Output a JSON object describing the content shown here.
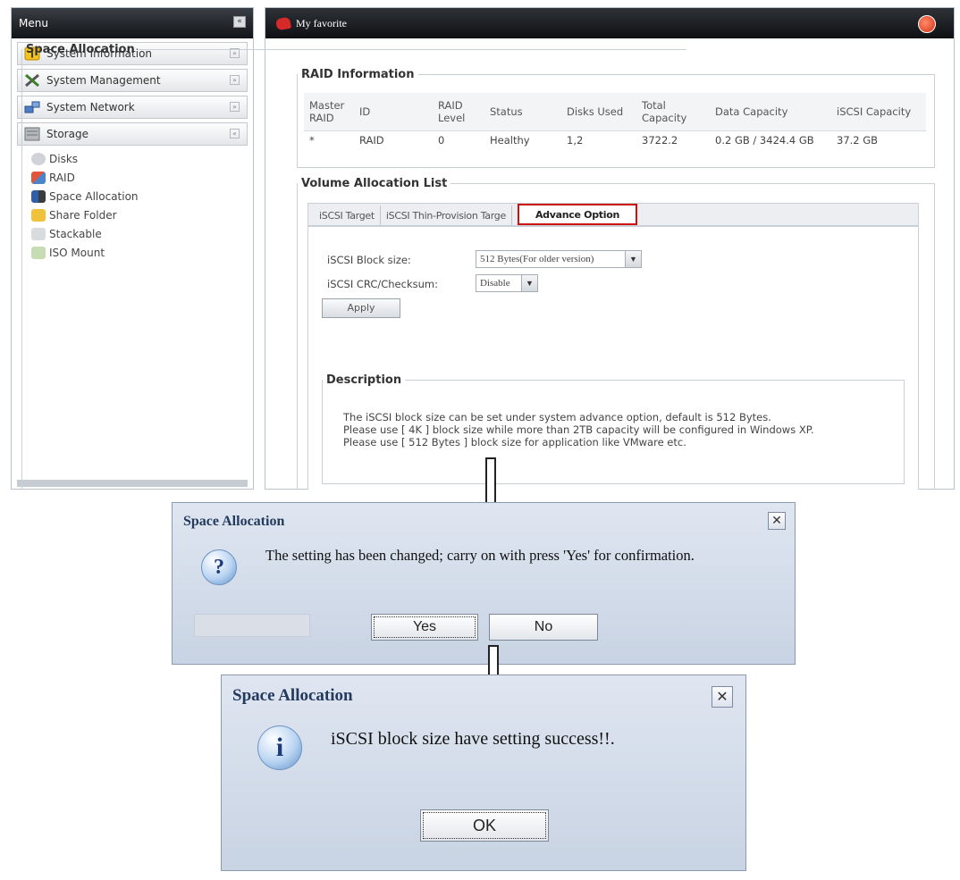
{
  "menu": {
    "title": "Menu",
    "collapse_icon": "«",
    "groups": [
      {
        "label": "System Information",
        "icon": "info-icon"
      },
      {
        "label": "System Management",
        "icon": "tools-icon"
      },
      {
        "label": "System Network",
        "icon": "network-icon"
      },
      {
        "label": "Storage",
        "icon": "storage-icon"
      }
    ],
    "storage_items": [
      {
        "label": "Disks",
        "icon": "disk-icon"
      },
      {
        "label": "RAID",
        "icon": "raid-icon"
      },
      {
        "label": "Space Allocation",
        "icon": "space-allocation-icon"
      },
      {
        "label": "Share Folder",
        "icon": "folder-icon"
      },
      {
        "label": "Stackable",
        "icon": "stackable-icon"
      },
      {
        "label": "ISO Mount",
        "icon": "iso-mount-icon"
      }
    ]
  },
  "header": {
    "favorite_label": "My favorite"
  },
  "space_allocation": {
    "title": "Space Allocation",
    "raid_info": {
      "title": "RAID Information",
      "columns": [
        "Master RAID",
        "ID",
        "RAID Level",
        "Status",
        "Disks Used",
        "Total Capacity",
        "Data Capacity",
        "iSCSI Capacity"
      ],
      "rows": [
        [
          "*",
          "RAID",
          "0",
          "Healthy",
          "1,2",
          "3722.2",
          "0.2 GB / 3424.4 GB",
          "37.2 GB"
        ]
      ]
    },
    "volume_list": {
      "title": "Volume Allocation List",
      "tabs": [
        "iSCSI Target",
        "iSCSI Thin-Provision Targe",
        "Advance Option"
      ],
      "block_size_label": "iSCSI Block size:",
      "block_size_value": "512 Bytes(For older version)",
      "crc_label": "iSCSI CRC/Checksum:",
      "crc_value": "Disable",
      "apply_label": "Apply",
      "description": {
        "title": "Description",
        "lines": [
          "The iSCSI block size can be set under system advance option, default is 512 Bytes.",
          "Please use [ 4K ] block size while more than 2TB capacity will be configured in Windows XP.",
          "Please use [ 512 Bytes ] block size for application like VMware etc."
        ]
      }
    }
  },
  "confirm_dialog": {
    "title": "Space Allocation",
    "message": "The setting has been changed; carry on with press 'Yes' for confirmation.",
    "icon_glyph": "?",
    "yes_label": "Yes",
    "no_label": "No",
    "close_glyph": "✕"
  },
  "success_dialog": {
    "title": "Space Allocation",
    "message": "iSCSI block size have setting success!!.",
    "icon_glyph": "i",
    "ok_label": "OK",
    "close_glyph": "✕"
  },
  "colors": {
    "highlight_border": "#cc1111",
    "dialog_title": "#23395d"
  }
}
